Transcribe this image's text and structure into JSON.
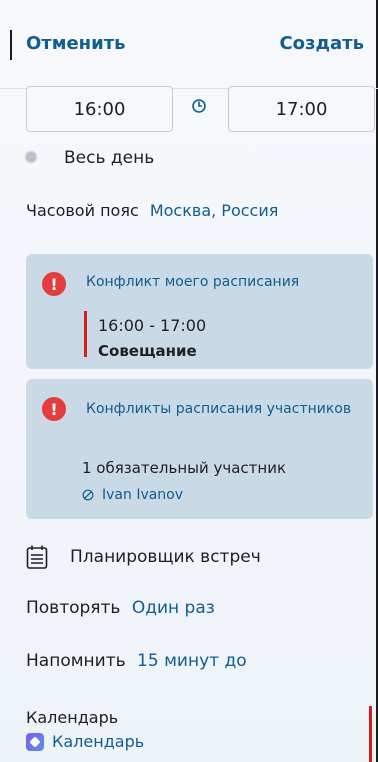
{
  "header": {
    "cancel": "Отменить",
    "create": "Создать"
  },
  "time": {
    "start": "16:00",
    "end": "17:00"
  },
  "all_day": {
    "label": "Весь день"
  },
  "timezone": {
    "label": "Часовой пояс",
    "value": "Москва, Россия"
  },
  "conflicts": {
    "my_schedule": {
      "title": "Конфликт моего расписания",
      "time_range": "16:00 - 17:00",
      "subject": "Совещание"
    },
    "participants": {
      "title": "Конфликты расписания участников",
      "summary": "1 обязательный участник",
      "person": "Ivan Ivanov"
    }
  },
  "planner": {
    "label": "Планировщик встреч"
  },
  "repeat": {
    "label": "Повторять",
    "value": "Один раз"
  },
  "remind": {
    "label": "Напомнить",
    "value": "15 минут до"
  },
  "calendar": {
    "label": "Календарь",
    "value": "Календарь"
  },
  "icons": {
    "clock": "clock-icon",
    "warning": "exclamation-icon",
    "ban": "ban-icon",
    "calendar": "calendar-icon"
  },
  "colors": {
    "accent": "#115d8f",
    "warning": "#e53d3d",
    "conflict_bar": "#d71c1c",
    "card_bg": "#c9d9e6"
  }
}
